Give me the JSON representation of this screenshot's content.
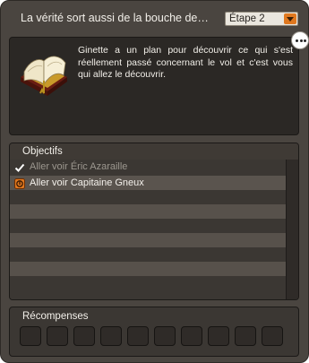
{
  "window": {
    "title": "La vérité sort aussi de la bouche des a...",
    "step_value": "Étape 2"
  },
  "description": {
    "text": "Ginette a un plan pour découvrir ce qui s'est réellement passé concernant le vol et c'est vous qui allez le découvrir.",
    "icon": "open-book-icon"
  },
  "objectives": {
    "header": "Objectifs",
    "items": [
      {
        "label": "Aller voir Éric Azaraille",
        "status": "completed",
        "icon": "checkmark-icon"
      },
      {
        "label": "Aller voir Capitaine Gneux",
        "status": "active",
        "icon": "orange-marker-icon"
      }
    ],
    "visible_row_count": 9
  },
  "rewards": {
    "header": "Récompenses",
    "slot_count": 10
  },
  "colors": {
    "window_bg": "#4a4540",
    "accent_orange": "#e0781f",
    "completed_text": "#9c978f",
    "active_text": "#f4f1ec"
  }
}
